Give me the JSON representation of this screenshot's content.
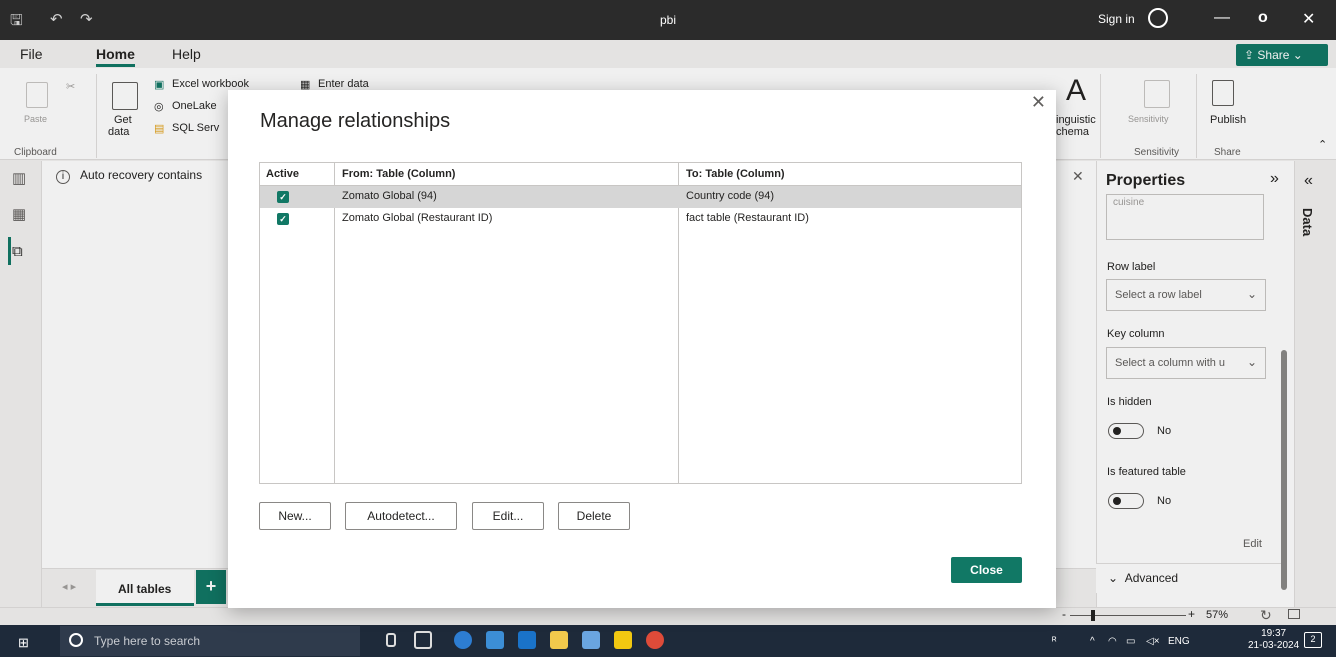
{
  "window": {
    "title": "pbi",
    "sign_in": "Sign in",
    "minimize": "—",
    "restore": "o",
    "close": "✕"
  },
  "menu": {
    "file": "File",
    "home": "Home",
    "help": "Help",
    "share": "Share"
  },
  "ribbon": {
    "paste": "Paste",
    "clipboard_group": "Clipboard",
    "get_data": "Get",
    "get_data2": "data",
    "excel": "Excel workbook",
    "onelake": "OneLake",
    "sql": "SQL Serv",
    "enter_data": "Enter data",
    "linguistic": "inguistic",
    "schema": "chema",
    "sensitivity": "Sensitivity",
    "sensitivity_group": "Sensitivity",
    "publish": "Publish",
    "share_group": "Share"
  },
  "notice": {
    "text": "Auto recovery contains"
  },
  "bottom_tabs": {
    "all_tables": "All tables",
    "add": "+"
  },
  "properties": {
    "title": "Properties",
    "textarea_value": "cuisine",
    "row_label_label": "Row label",
    "row_label_placeholder": "Select a row label",
    "key_column_label": "Key column",
    "key_column_placeholder": "Select a column with u",
    "is_hidden_label": "Is hidden",
    "is_hidden_value": "No",
    "is_featured_label": "Is featured table",
    "is_featured_value": "No",
    "edit": "Edit",
    "advanced": "Advanced"
  },
  "data_pane": {
    "label": "Data"
  },
  "status": {
    "zoom": "57%",
    "zoom_level_fraction": 0.2
  },
  "taskbar": {
    "search_placeholder": "Type here to search",
    "lang": "ENG",
    "time": "19:37",
    "date": "21-03-2024",
    "notification_count": "2"
  },
  "dialog": {
    "title": "Manage relationships",
    "columns": {
      "active": "Active",
      "from": "From: Table (Column)",
      "to": "To: Table (Column)"
    },
    "rows": [
      {
        "active": true,
        "from": "Zomato Global (94)",
        "to": "Country code (94)",
        "selected": true
      },
      {
        "active": true,
        "from": "Zomato Global (Restaurant ID)",
        "to": "fact table (Restaurant ID)",
        "selected": false
      }
    ],
    "buttons": {
      "new": "New...",
      "autodetect": "Autodetect...",
      "edit": "Edit...",
      "delete": "Delete",
      "close": "Close"
    }
  },
  "colors": {
    "accent": "#117865",
    "titlebar": "#2b2b2b",
    "taskbar": "#1e2a3a"
  }
}
